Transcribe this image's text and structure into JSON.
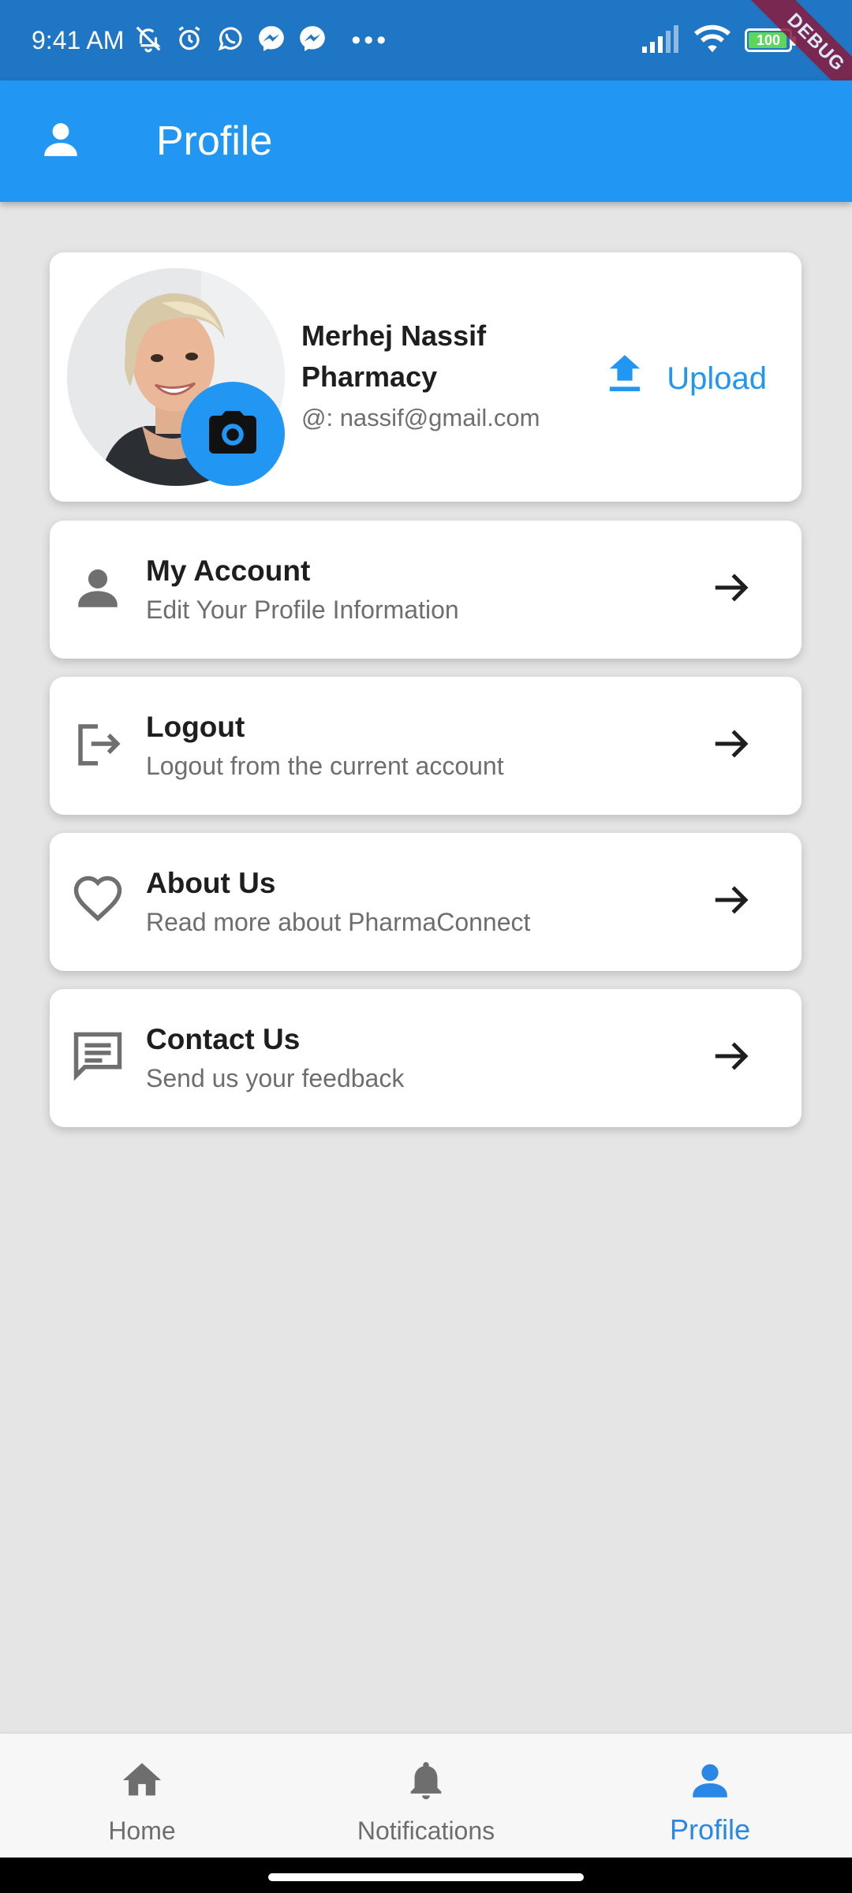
{
  "status_bar": {
    "time": "9:41 AM",
    "more_dots": "•••",
    "battery": "100",
    "debug_label": "DEBUG",
    "icons": [
      "muted-alarm-icon",
      "alarm-clock-icon",
      "whatsapp-icon",
      "messenger-icon",
      "messenger-icon",
      "signal-icon",
      "wifi-icon",
      "battery-icon"
    ]
  },
  "app_bar": {
    "title": "Profile",
    "icon": "person-icon",
    "color": "#2196f3"
  },
  "profile": {
    "name": "Merhej Nassif Pharmacy",
    "email": "@: nassif@gmail.com",
    "upload_label": "Upload",
    "camera_icon": "camera-icon"
  },
  "menu": [
    {
      "title": "My Account",
      "subtitle": "Edit Your Profile Information",
      "icon": "person-icon"
    },
    {
      "title": "Logout",
      "subtitle": "Logout from the current account",
      "icon": "logout-icon"
    },
    {
      "title": "About Us",
      "subtitle": "Read more about PharmaConnect",
      "icon": "heart-icon"
    },
    {
      "title": "Contact Us",
      "subtitle": "Send us your feedback",
      "icon": "chat-icon"
    }
  ],
  "bottom_nav": {
    "items": [
      {
        "label": "Home",
        "icon": "home-icon"
      },
      {
        "label": "Notifications",
        "icon": "bell-icon"
      },
      {
        "label": "Profile",
        "icon": "person-icon",
        "active": true
      }
    ],
    "active_color": "#2a87e6"
  }
}
